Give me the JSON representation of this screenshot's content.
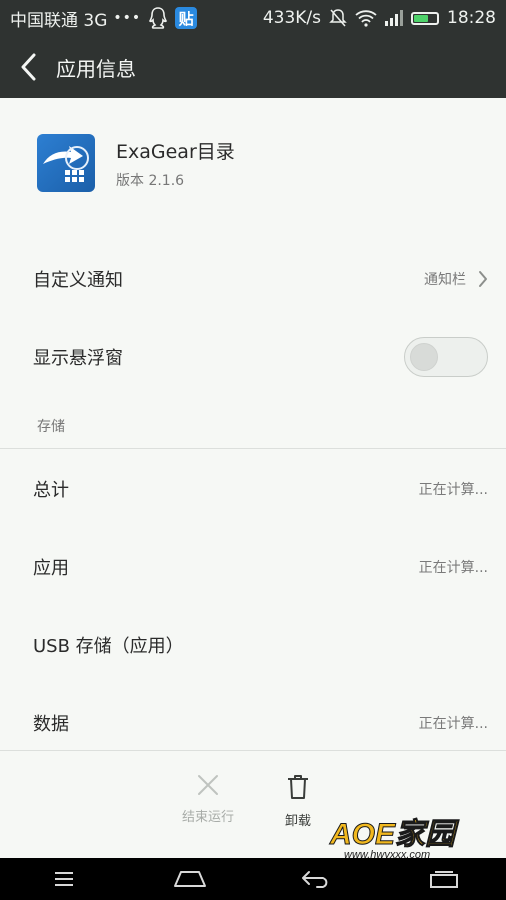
{
  "status_bar": {
    "carrier": "中国联通 3G",
    "dots": "•••",
    "tie_icon_label": "贴",
    "speed": "433K/s",
    "time": "18:28",
    "icons": [
      "qq-icon",
      "tieba-icon",
      "mute-bell-icon",
      "wifi-icon",
      "signal-icon",
      "battery-icon"
    ]
  },
  "header": {
    "title": "应用信息"
  },
  "app": {
    "name": "ExaGear目录",
    "version": "版本 2.1.6"
  },
  "settings": {
    "custom_notify_label": "自定义通知",
    "custom_notify_value": "通知栏",
    "floating_window_label": "显示悬浮窗",
    "floating_window_on": false
  },
  "storage": {
    "section_label": "存储",
    "rows": [
      {
        "label": "总计",
        "value": "正在计算..."
      },
      {
        "label": "应用",
        "value": "正在计算..."
      },
      {
        "label": "USB 存储（应用）",
        "value": ""
      },
      {
        "label": "数据",
        "value": "正在计算..."
      }
    ]
  },
  "actions": {
    "force_stop_label": "结束运行",
    "force_stop_enabled": false,
    "uninstall_label": "卸载"
  },
  "watermark": {
    "brand": "AOE家园",
    "url": "www.hwyxxx.com"
  },
  "colors": {
    "bar_bg": "#2f3331",
    "page_bg": "#f6f8f5",
    "accent_blue": "#2a8ae0"
  }
}
